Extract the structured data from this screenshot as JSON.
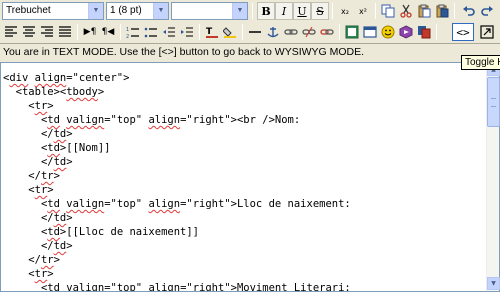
{
  "toolbar": {
    "font_select": "Trebuchet",
    "size_select": "1 (8 pt)",
    "format_select": "",
    "bold_label": "B",
    "italic_label": "I",
    "underline_label": "U",
    "strike_label": "S",
    "subscript_label": "x₂",
    "superscript_label": "x²",
    "ltr_label": "▶¶",
    "rtl_label": "¶◀",
    "toggle_html_label": "<>",
    "icons": [
      "cut-icon",
      "copy-icon",
      "paste-icon",
      "paste-word-icon",
      "undo-icon",
      "redo-icon"
    ]
  },
  "status": {
    "message": "You are in TEXT MODE. Use the [<>] button to go back to WYSIWYG MODE."
  },
  "tooltip": {
    "text": "Toggle HTML Source"
  },
  "code_lines": [
    {
      "indent": "",
      "text": "<div align=\"center\">"
    },
    {
      "indent": "  ",
      "text": "<table><tbody>"
    },
    {
      "indent": "    ",
      "text": "<tr>"
    },
    {
      "indent": "      ",
      "text": "<td valign=\"top\" align=\"right\"><br />Nom:"
    },
    {
      "indent": "      ",
      "text": "</td>"
    },
    {
      "indent": "      ",
      "text": "<td>[[Nom]]"
    },
    {
      "indent": "      ",
      "text": "</td>"
    },
    {
      "indent": "    ",
      "text": "</tr>"
    },
    {
      "indent": "    ",
      "text": "<tr>"
    },
    {
      "indent": "      ",
      "text": "<td valign=\"top\" align=\"right\">Lloc de naixement:"
    },
    {
      "indent": "      ",
      "text": "</td>"
    },
    {
      "indent": "      ",
      "text": "<td>[[Lloc de naixement]]"
    },
    {
      "indent": "      ",
      "text": "</td>"
    },
    {
      "indent": "    ",
      "text": "</tr>"
    },
    {
      "indent": "    ",
      "text": "<tr>"
    },
    {
      "indent": "      ",
      "text": "<td valign=\"top\" align=\"right\">Moviment Literari:"
    }
  ],
  "colors": {
    "toolbar_bg": "#ece9d8",
    "editor_bg": "#ffffff",
    "spell_underline": "#e23a3a",
    "tooltip_bg": "#ffffe1"
  }
}
